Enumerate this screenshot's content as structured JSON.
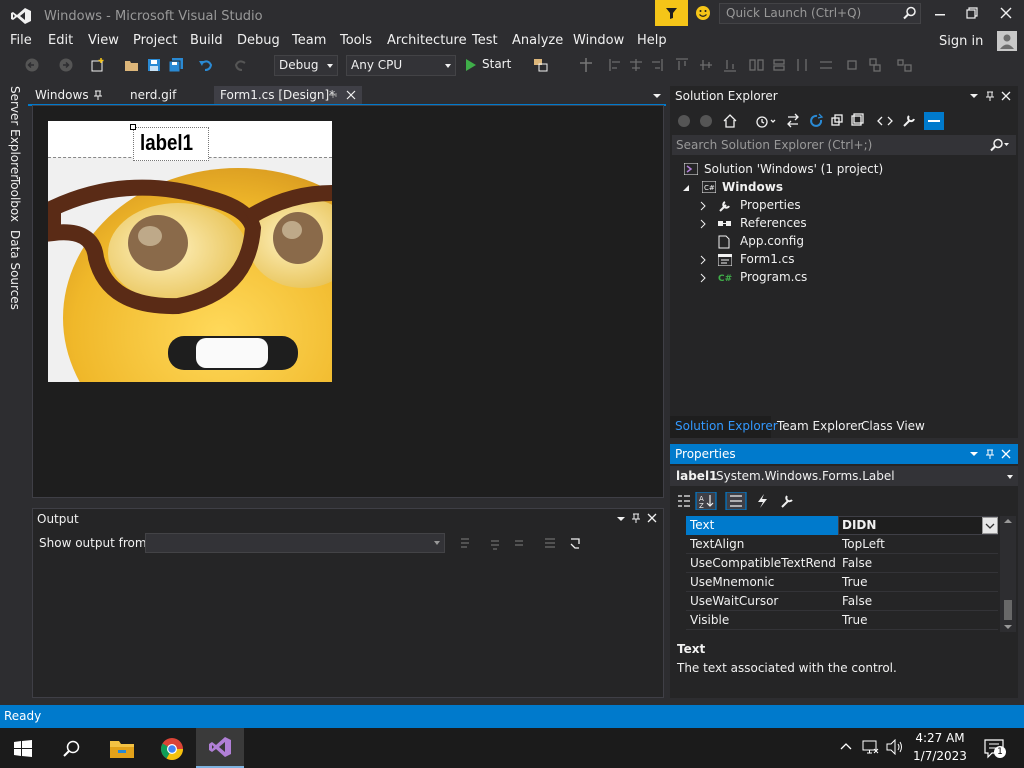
{
  "window": {
    "title": "Windows - Microsoft Visual Studio",
    "quick_launch_placeholder": "Quick Launch (Ctrl+Q)"
  },
  "menu": [
    "File",
    "Edit",
    "View",
    "Project",
    "Build",
    "Debug",
    "Team",
    "Tools",
    "Architecture",
    "Test",
    "Analyze",
    "Window",
    "Help"
  ],
  "signin": "Sign in",
  "toolbar": {
    "config": "Debug",
    "platform": "Any CPU",
    "start_label": "Start"
  },
  "left_strip": [
    "Server Explorer",
    "Toolbox",
    "Data Sources"
  ],
  "doc_tabs": [
    {
      "label": "Windows"
    },
    {
      "label": "nerd.gif"
    },
    {
      "label": "Form1.cs [Design]*"
    }
  ],
  "designer": {
    "label_text": "label1"
  },
  "output": {
    "title": "Output",
    "show_from_label": "Show output from:"
  },
  "solution_explorer": {
    "title": "Solution Explorer",
    "search_placeholder": "Search Solution Explorer (Ctrl+;)",
    "solution": "Solution 'Windows' (1 project)",
    "project": "Windows",
    "items": [
      "Properties",
      "References",
      "App.config",
      "Form1.cs",
      "Program.cs"
    ],
    "bottom_tabs": [
      "Solution Explorer",
      "Team Explorer",
      "Class View"
    ]
  },
  "properties": {
    "title": "Properties",
    "object": "label1",
    "object_type": "System.Windows.Forms.Label",
    "rows": [
      {
        "name": "Text",
        "value": "DIDN"
      },
      {
        "name": "TextAlign",
        "value": "TopLeft"
      },
      {
        "name": "UseCompatibleTextRenderin",
        "value": "False"
      },
      {
        "name": "UseMnemonic",
        "value": "True"
      },
      {
        "name": "UseWaitCursor",
        "value": "False"
      },
      {
        "name": "Visible",
        "value": "True"
      }
    ],
    "desc_title": "Text",
    "desc_text": "The text associated with the control."
  },
  "status": {
    "text": "Ready"
  },
  "taskbar": {
    "time": "4:27 AM",
    "date": "1/7/2023",
    "notif_count": "1"
  },
  "colors": {
    "accent": "#007acc",
    "vs_purple": "#68217a",
    "bg": "#2d2d30"
  }
}
